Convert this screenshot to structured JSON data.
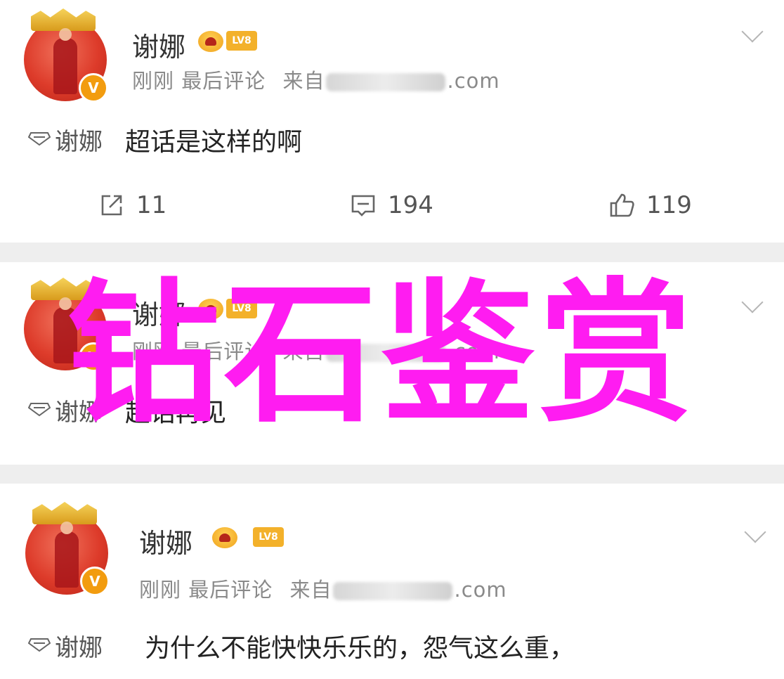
{
  "posts": [
    {
      "name": "谢娜",
      "level_badge": "LV8",
      "verified_mark": "V",
      "time": "刚刚",
      "action": "最后评论",
      "source_prefix": "来自",
      "source_suffix": ".com",
      "topic": "谢娜",
      "text": "超话是这样的啊",
      "reposts": "11",
      "comments": "194",
      "likes": "119"
    },
    {
      "name": "谢娜",
      "level_badge": "LV8",
      "verified_mark": "V",
      "time": "刚刚",
      "action": "最后评论",
      "source_prefix": "来自",
      "source_suffix": ".com",
      "topic": "谢娜",
      "text": "超话再见"
    },
    {
      "name": "谢娜",
      "level_badge": "LV8",
      "verified_mark": "V",
      "time": "刚刚",
      "action": "最后评论",
      "source_prefix": "来自",
      "source_suffix": ".com",
      "topic": "谢娜",
      "text": "为什么不能快快乐乐的，怨气这么重，"
    }
  ],
  "watermark": "钻石鉴赏",
  "colors": {
    "watermark": "#ff1cf1",
    "avatar": "#dd3b2a",
    "badge_gold": "#f3b12a",
    "divider": "#eeeeee",
    "meta_text": "#8a8a8a"
  },
  "icons": [
    "chevron-down-icon",
    "topic-diamond-icon",
    "repost-icon",
    "comment-icon",
    "like-icon",
    "crown-badge-icon",
    "verified-v-icon"
  ]
}
